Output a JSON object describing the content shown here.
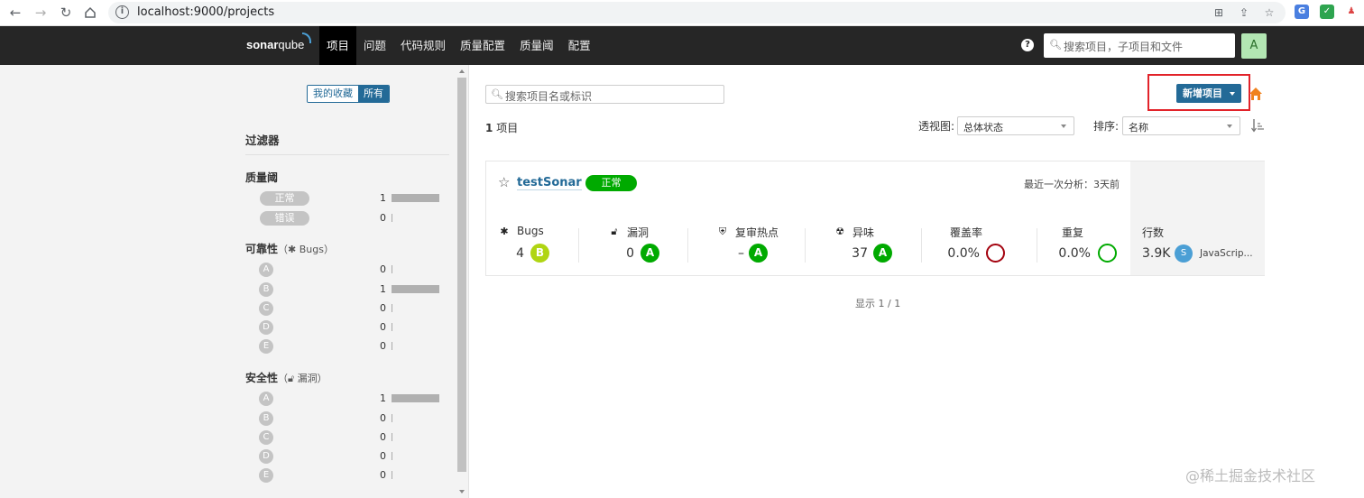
{
  "browser": {
    "url": "localhost:9000/projects",
    "back_icon": "arrow-left-icon",
    "forward_icon": "arrow-right-icon",
    "reload_icon": "reload-icon",
    "home_icon": "home-icon"
  },
  "navbar": {
    "logo_bold": "sonar",
    "logo_regular": "qube",
    "items": [
      "项目",
      "问题",
      "代码规则",
      "质量配置",
      "质量阈",
      "配置"
    ],
    "active_index": 0,
    "search_placeholder": "搜索项目，子项目和文件",
    "avatar_letter": "A",
    "help": "?"
  },
  "sidebar": {
    "toggle": {
      "favorites": "我的收藏",
      "all": "所有"
    },
    "filter_title": "过滤器",
    "quality_gate": {
      "title": "质量阈",
      "options": [
        {
          "label": "正常",
          "count": "1",
          "fraction": 1
        },
        {
          "label": "错误",
          "count": "0",
          "fraction": 0
        }
      ]
    },
    "reliability": {
      "title": "可靠性",
      "paren_open": "（",
      "sub": "Bugs",
      "paren_close": "）",
      "ratings": [
        {
          "label": "A",
          "count": "0",
          "fraction": 0
        },
        {
          "label": "B",
          "count": "1",
          "fraction": 1
        },
        {
          "label": "C",
          "count": "0",
          "fraction": 0
        },
        {
          "label": "D",
          "count": "0",
          "fraction": 0
        },
        {
          "label": "E",
          "count": "0",
          "fraction": 0
        }
      ]
    },
    "security": {
      "title": "安全性",
      "paren_open": "（",
      "sub": "漏洞",
      "paren_close": "）",
      "ratings": [
        {
          "label": "A",
          "count": "1",
          "fraction": 1
        },
        {
          "label": "B",
          "count": "0",
          "fraction": 0
        },
        {
          "label": "C",
          "count": "0",
          "fraction": 0
        },
        {
          "label": "D",
          "count": "0",
          "fraction": 0
        },
        {
          "label": "E",
          "count": "0",
          "fraction": 0
        }
      ]
    }
  },
  "main": {
    "search_placeholder": "搜索项目名或标识",
    "new_project_label": "新增项目",
    "project_count": "1",
    "project_count_suffix": "项目",
    "perspective_label": "透视图:",
    "perspective_value": "总体状态",
    "sort_label": "排序:",
    "sort_value": "名称",
    "pager": "显示 1 / 1"
  },
  "project": {
    "name": "testSonar",
    "quality_gate": "正常",
    "last_analysis": "最近一次分析：3天前",
    "metrics": {
      "bugs": {
        "label": "Bugs",
        "value": "4",
        "rating": "B"
      },
      "vulnerabilities": {
        "label": "漏洞",
        "value": "0",
        "rating": "A"
      },
      "hotspots": {
        "label": "复审热点",
        "value": "–",
        "rating": "A"
      },
      "code_smells": {
        "label": "异味",
        "value": "37",
        "rating": "A"
      },
      "coverage": {
        "label": "覆盖率",
        "value": "0.0%"
      },
      "duplications": {
        "label": "重复",
        "value": "0.0%"
      }
    },
    "lines": {
      "label": "行数",
      "value": "3.9K",
      "size_letter": "S",
      "languages": "JavaScrip..."
    }
  },
  "watermark": "@稀土掘金技术社区",
  "colors": {
    "navbar": "#262626",
    "primary": "#236a97",
    "ok": "#00aa00",
    "rating_b": "#b0d513",
    "coverage_ring": "#a4030f",
    "highlight": "#e2232a"
  }
}
